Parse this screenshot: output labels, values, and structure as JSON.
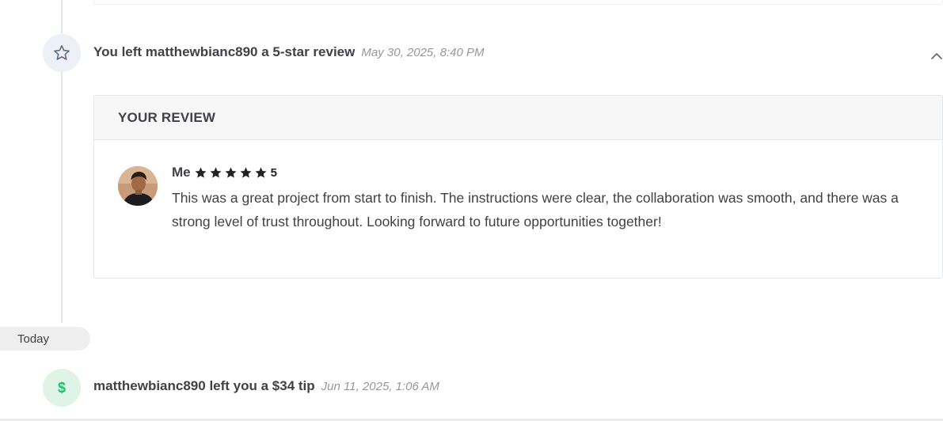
{
  "timeline": {
    "review_event": {
      "title": "You left matthewbianc890 a 5-star review",
      "timestamp": "May 30, 2025, 8:40 PM",
      "icon": "star-icon"
    },
    "review_card": {
      "header": "YOUR REVIEW",
      "reviewer": "Me",
      "rating": 5,
      "rating_label": "5",
      "text": "This was a great project from start to finish. The instructions were clear, the collaboration was smooth, and there was a strong level of trust throughout. Looking forward to future opportunities together!"
    },
    "date_divider": "Today",
    "tip_event": {
      "title": "matthewbianc890 left you a $34 tip",
      "timestamp": "Jun 11, 2025, 1:06 AM",
      "icon_glyph": "$",
      "icon": "dollar-icon"
    }
  },
  "colors": {
    "star_circle_bg": "#eef0f7",
    "tip_circle_bg": "#dff3e6",
    "tip_accent": "#1dbf73",
    "text_primary": "#404145",
    "text_muted": "#95979d"
  }
}
